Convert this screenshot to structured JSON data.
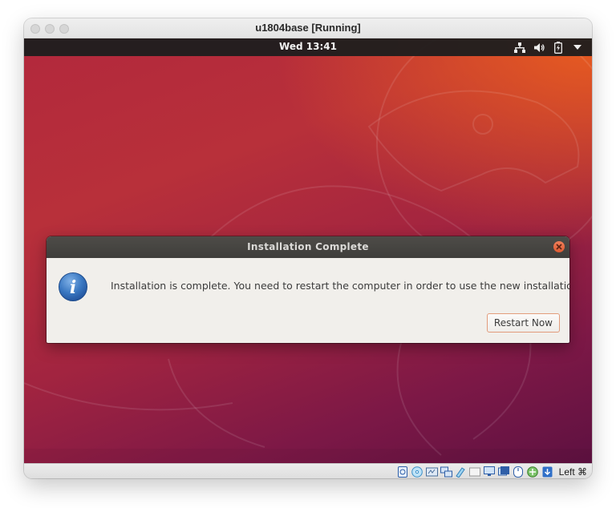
{
  "window": {
    "title": "u1804base [Running]"
  },
  "top_bar": {
    "clock": "Wed 13:41",
    "tray_icons": [
      "network-icon",
      "volume-icon",
      "battery-icon",
      "system-menu-arrow-icon"
    ]
  },
  "dialog": {
    "title": "Installation Complete",
    "message": "Installation is complete. You need to restart the computer in order to use the new installation.",
    "button_label": "Restart Now",
    "icon": "info-icon"
  },
  "status_bar": {
    "host_key_label": "Left ⌘",
    "icons": [
      "hard-disk-icon",
      "optical-drive-icon",
      "audio-icon",
      "network-adapters-icon",
      "usb-icon",
      "shared-folders-icon",
      "display-icon",
      "video-capture-icon",
      "mouse-integration-icon",
      "cpu-icon",
      "keyboard-icon"
    ]
  },
  "colors": {
    "ubuntu_orange": "#e95420",
    "aubergine": "#77216f",
    "top_bar": "#1d1d1d",
    "dialog_header": "#45433f",
    "close_button": "#e6643c"
  }
}
